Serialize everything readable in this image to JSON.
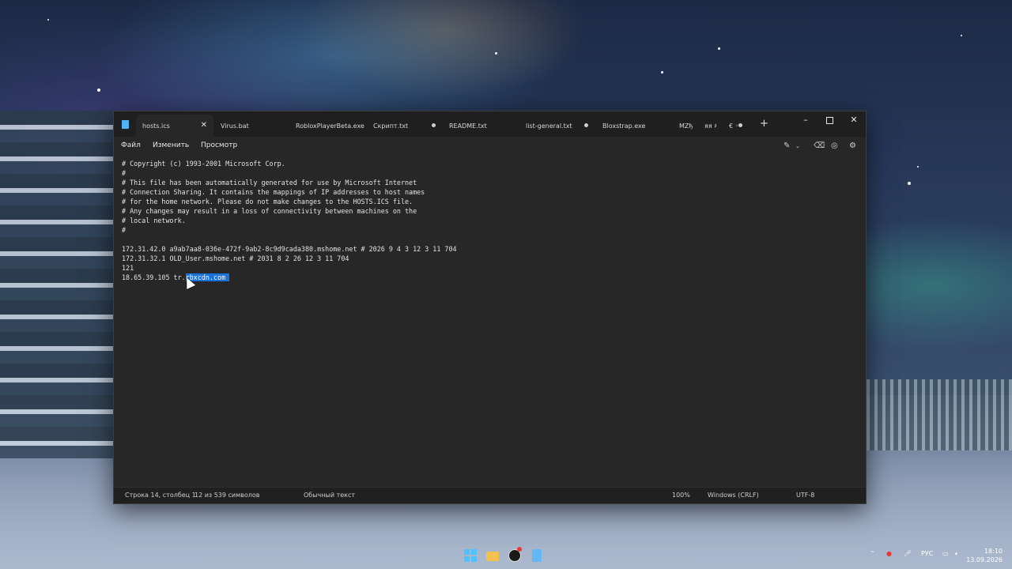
{
  "window": {
    "tabs": [
      {
        "label": "hosts.ics",
        "active": true,
        "close": "✕"
      },
      {
        "label": "Virus.bat"
      },
      {
        "label": "RobloxPlayerBeta.exe"
      },
      {
        "label": "Скрипт.txt",
        "modified": true
      },
      {
        "label": "README.txt"
      },
      {
        "label": "list-general.txt",
        "modified": true
      },
      {
        "label": "Bloxstrap.exe"
      },
      {
        "label": "MZђ"
      },
      {
        "label": "яя ♯"
      },
      {
        "label": "€ ◦"
      }
    ],
    "new_tab": "+",
    "controls": {
      "minimize": "–",
      "close": "✕"
    }
  },
  "menu": {
    "file": "Файл",
    "edit": "Изменить",
    "view": "Просмотр"
  },
  "toolbar_icons": [
    "copilot-icon",
    "chevron-down-icon",
    "ink-icon",
    "format-icon",
    "account-icon",
    "settings-icon"
  ],
  "editor": {
    "lines": [
      "# Copyright (c) 1993-2001 Microsoft Corp.",
      "#",
      "# This file has been automatically generated for use by Microsoft Internet",
      "# Connection Sharing. It contains the mappings of IP addresses to host names",
      "# for the home network. Please do not make changes to the HOSTS.ICS file.",
      "# Any changes may result in a loss of connectivity between machines on the",
      "# local network.",
      "#",
      "",
      "172.31.42.0 a9ab7aa8-036e-472f-9ab2-8c9d9cada380.mshome.net # 2026 9 4 3 12 3 11 704",
      "172.31.32.1 OLD_User.mshome.net # 2031 8 2 26 12 3 11 704",
      "121"
    ],
    "last_line_prefix": "18.65.39.105 tr.",
    "last_line_selected": "rbxcdn.com "
  },
  "status": {
    "position": "Строка 14, столбец 1",
    "selection": "12 из 539 символов",
    "format": "Обычный текст",
    "zoom": "100%",
    "line_ending": "Windows (CRLF)",
    "encoding": "UTF-8"
  },
  "tray": {
    "lang": "РУС"
  },
  "clock": {
    "time": "18:10",
    "date": "13.09.2026"
  },
  "colors": {
    "accent": "#1a73d8",
    "editor_bg": "#272727",
    "titlebar_bg": "#1f1f1f"
  }
}
